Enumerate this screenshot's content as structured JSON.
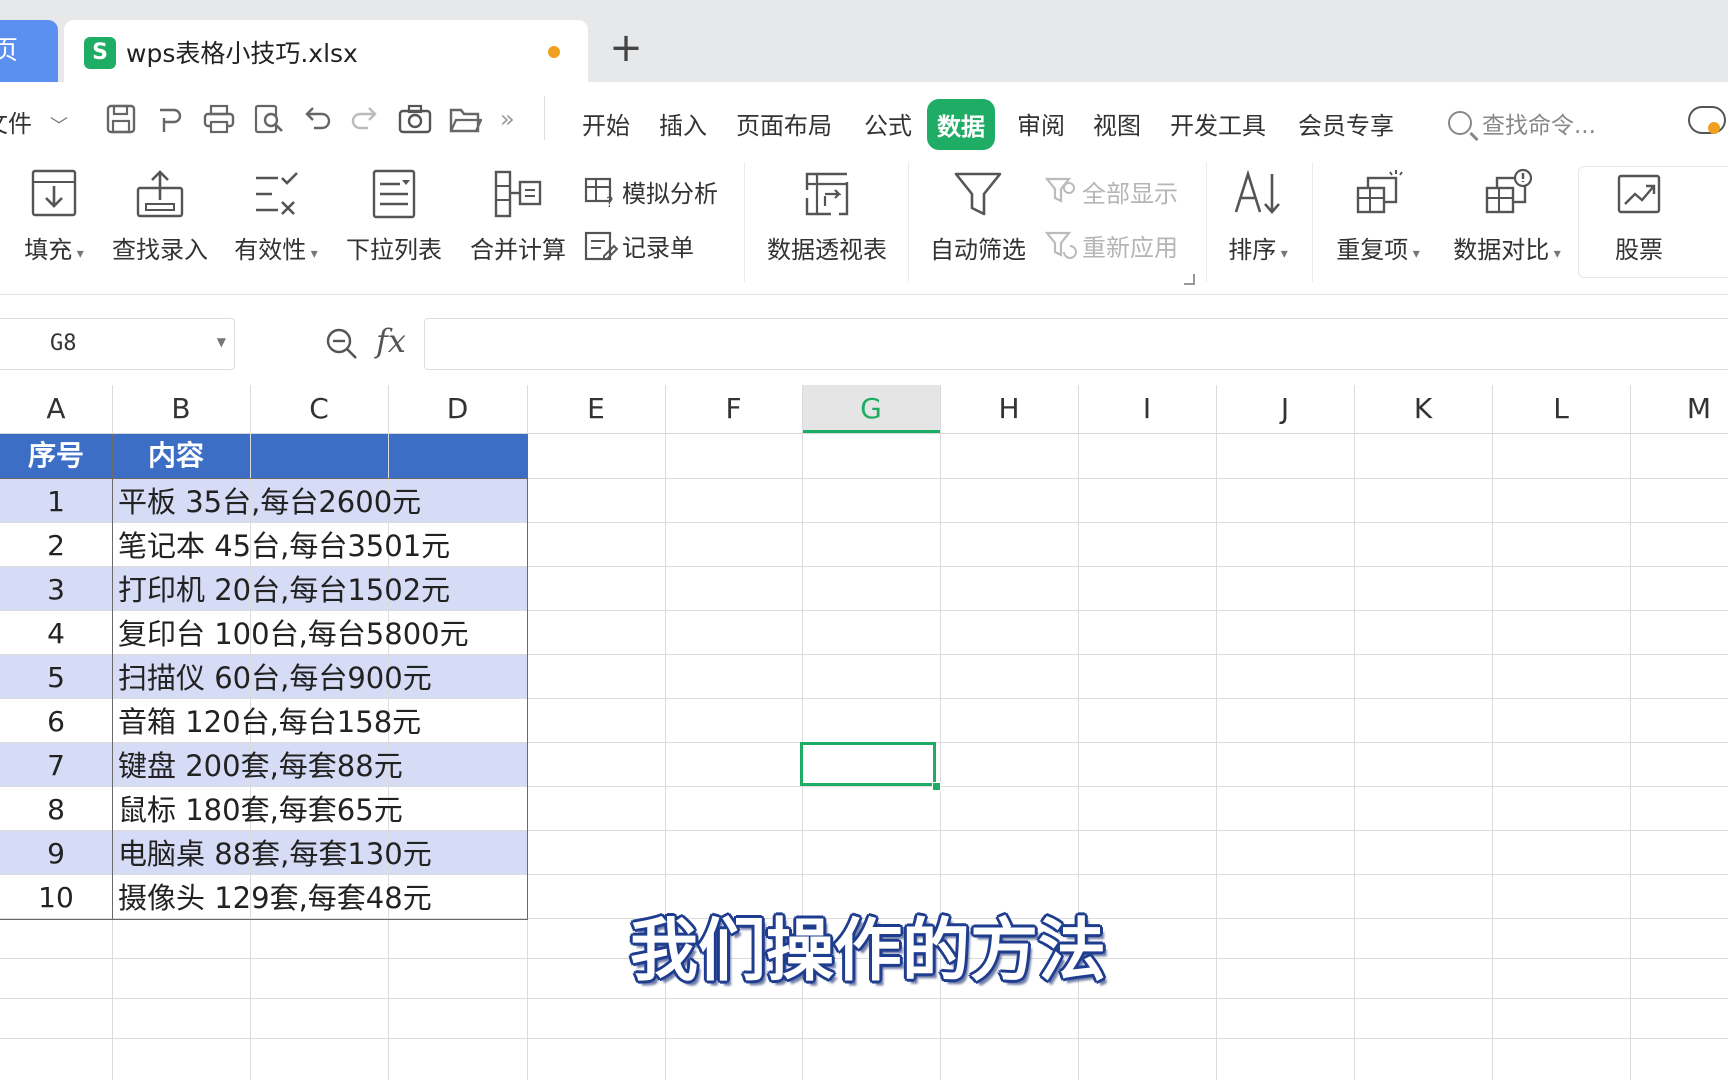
{
  "tabs": {
    "home_label": "页",
    "file_title": "wps表格小技巧.xlsx",
    "add_label": "+"
  },
  "menu": {
    "file_label": "文件",
    "tabs": [
      "开始",
      "插入",
      "页面布局",
      "公式",
      "数据",
      "审阅",
      "视图",
      "开发工具",
      "会员专享"
    ],
    "active_tab": "数据",
    "search_placeholder": "查找命令..."
  },
  "ribbon": {
    "fill": "填充",
    "find_entry": "查找录入",
    "validity": "有效性",
    "dropdown_list": "下拉列表",
    "consolidate": "合并计算",
    "what_if": "模拟分析",
    "record_form": "记录单",
    "pivot": "数据透视表",
    "auto_filter": "自动筛选",
    "show_all": "全部显示",
    "reapply": "重新应用",
    "sort": "排序",
    "duplicates": "重复项",
    "compare": "数据对比",
    "stock": "股票"
  },
  "formula_bar": {
    "cell_ref": "G8",
    "fx_label": "fx",
    "formula": ""
  },
  "columns": [
    "A",
    "B",
    "C",
    "D",
    "E",
    "F",
    "G",
    "H",
    "I",
    "J",
    "K",
    "L",
    "M"
  ],
  "selected_column": "G",
  "table": {
    "headers": [
      "序号",
      "内容"
    ],
    "rows": [
      {
        "no": "1",
        "text": "平板 35台,每台2600元"
      },
      {
        "no": "2",
        "text": "笔记本 45台,每台3501元"
      },
      {
        "no": "3",
        "text": "打印机 20台,每台1502元"
      },
      {
        "no": "4",
        "text": "复印台 100台,每台5800元"
      },
      {
        "no": "5",
        "text": "扫描仪 60台,每台900元"
      },
      {
        "no": "6",
        "text": "音箱 120台,每台158元"
      },
      {
        "no": "7",
        "text": "键盘 200套,每套88元"
      },
      {
        "no": "8",
        "text": "鼠标 180套,每套65元"
      },
      {
        "no": "9",
        "text": "电脑桌 88套,每套130元"
      },
      {
        "no": "10",
        "text": "摄像头 129套,每套48元"
      }
    ]
  },
  "subtitle": "我们操作的方法",
  "colors": {
    "accent": "#1fad66",
    "table_header": "#3d6ec5",
    "band": "#d6dcf5",
    "modified_dot": "#f0a020"
  }
}
